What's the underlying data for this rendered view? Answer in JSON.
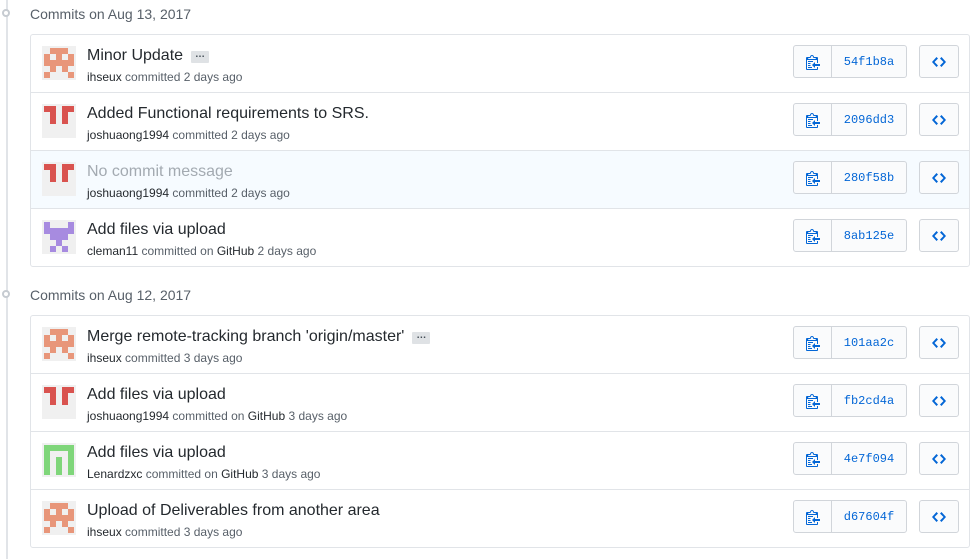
{
  "groups": [
    {
      "title": "Commits on Aug 13, 2017",
      "commits": [
        {
          "message": "Minor Update",
          "has_ellipsis": true,
          "empty": false,
          "author": "ihseux",
          "verb": " committed",
          "via": "",
          "time": " 2 days ago",
          "sha": "54f1b8a",
          "avatar": "ihseux",
          "highlight": false
        },
        {
          "message": "Added Functional requirements to SRS.",
          "has_ellipsis": false,
          "empty": false,
          "author": "joshuaong1994",
          "verb": " committed",
          "via": "",
          "time": " 2 days ago",
          "sha": "2096dd3",
          "avatar": "joshuaong1994",
          "highlight": false
        },
        {
          "message": "No commit message",
          "has_ellipsis": false,
          "empty": true,
          "author": "joshuaong1994",
          "verb": " committed",
          "via": "",
          "time": " 2 days ago",
          "sha": "280f58b",
          "avatar": "joshuaong1994",
          "highlight": true
        },
        {
          "message": "Add files via upload",
          "has_ellipsis": false,
          "empty": false,
          "author": "cleman11",
          "verb": " committed on ",
          "via": "GitHub",
          "time": " 2 days ago",
          "sha": "8ab125e",
          "avatar": "cleman11",
          "highlight": false
        }
      ]
    },
    {
      "title": "Commits on Aug 12, 2017",
      "commits": [
        {
          "message": "Merge remote-tracking branch 'origin/master'",
          "has_ellipsis": true,
          "empty": false,
          "author": "ihseux",
          "verb": " committed",
          "via": "",
          "time": " 3 days ago",
          "sha": "101aa2c",
          "avatar": "ihseux",
          "highlight": false
        },
        {
          "message": "Add files via upload",
          "has_ellipsis": false,
          "empty": false,
          "author": "joshuaong1994",
          "verb": " committed on ",
          "via": "GitHub",
          "time": " 3 days ago",
          "sha": "fb2cd4a",
          "avatar": "joshuaong1994",
          "highlight": false
        },
        {
          "message": "Add files via upload",
          "has_ellipsis": false,
          "empty": false,
          "author": "Lenardzxc",
          "verb": " committed on ",
          "via": "GitHub",
          "time": " 3 days ago",
          "sha": "4e7f094",
          "avatar": "Lenardzxc",
          "highlight": false
        },
        {
          "message": "Upload of Deliverables from another area",
          "has_ellipsis": false,
          "empty": false,
          "author": "ihseux",
          "verb": " committed",
          "via": "",
          "time": " 3 days ago",
          "sha": "d67604f",
          "avatar": "ihseux",
          "highlight": false
        }
      ]
    }
  ],
  "ellipsis_label": "…",
  "icons": {
    "copy": "clippy-icon",
    "browse": "code-icon",
    "dot": "git-commit-icon"
  },
  "colors": {
    "link": "#0366d6",
    "muted": "#586069",
    "border": "#e1e4e8",
    "highlight_row": "#f6fbff",
    "avatar_ihseux": "#e8967a",
    "avatar_joshuaong1994": "#d9534f",
    "avatar_cleman11": "#a78be0",
    "avatar_Lenardzxc": "#7fd67a"
  }
}
